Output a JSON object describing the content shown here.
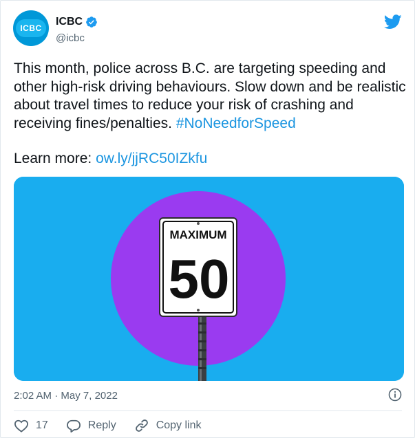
{
  "author": {
    "display_name": "ICBC",
    "handle": "@icbc",
    "avatar_text": "ICBC"
  },
  "tweet": {
    "text": "This month, police across B.C. are targeting speeding and other high-risk driving behaviours. Slow down and be realistic about travel times to reduce your risk of crashing and receiving fines/penalties.",
    "hashtag": "#NoNeedforSpeed",
    "learn_more_label": "Learn more:",
    "link": "ow.ly/jjRC50IZkfu"
  },
  "media": {
    "sign_top": "MAXIMUM",
    "sign_value": "50"
  },
  "meta": {
    "time": "2:02 AM",
    "separator": "·",
    "date": "May 7, 2022"
  },
  "actions": {
    "like_count": "17",
    "reply_label": "Reply",
    "copy_link_label": "Copy link"
  },
  "colors": {
    "link": "#1b95e0",
    "media_bg": "#19adef",
    "circle": "#9a3bf0",
    "avatar": "#0098d8"
  },
  "icons": [
    "verified-badge-icon",
    "twitter-bird-icon",
    "info-icon",
    "heart-icon",
    "reply-icon",
    "link-icon"
  ]
}
